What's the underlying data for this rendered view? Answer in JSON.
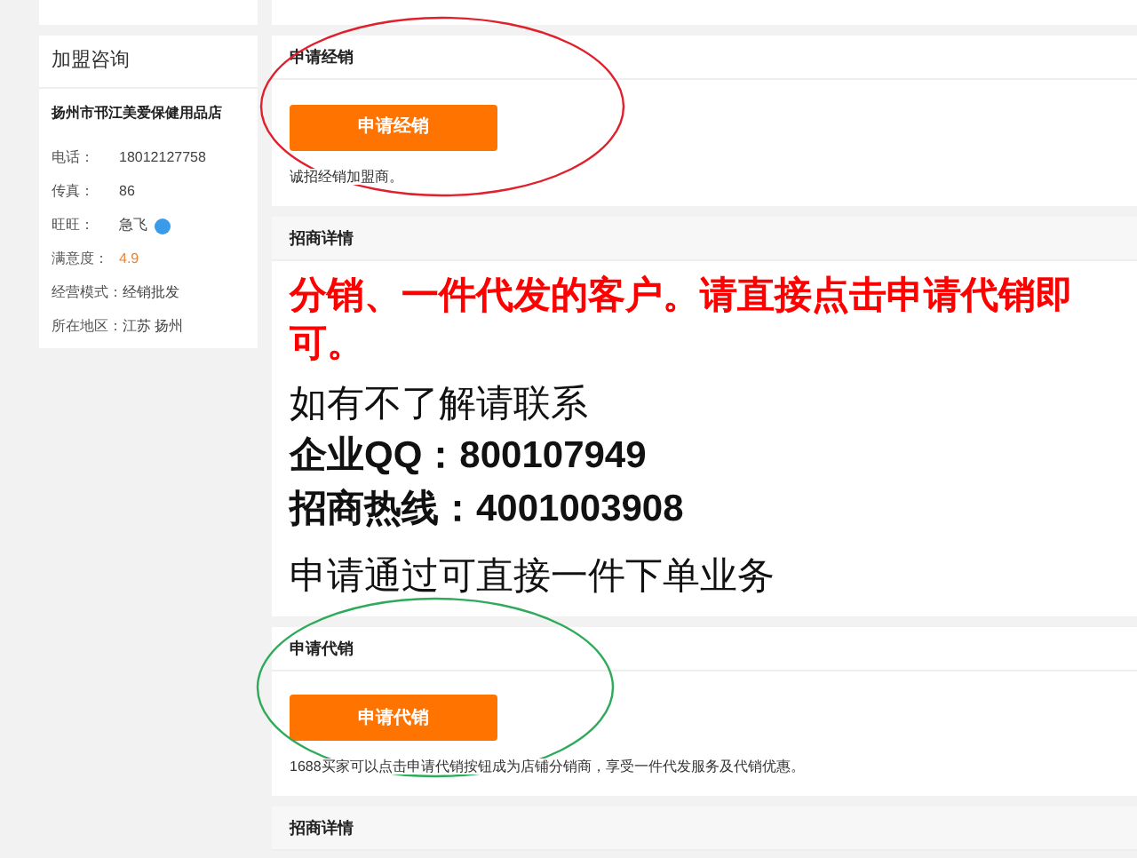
{
  "sidebar": {
    "title": "加盟咨询",
    "shop_name": "扬州市邗江美爱保健用品店",
    "fields": [
      {
        "label": "电话：",
        "value": "18012127758",
        "kind": "plain"
      },
      {
        "label": "传真：",
        "value": "86",
        "kind": "plain"
      },
      {
        "label": "旺旺：",
        "value": "急飞",
        "kind": "chat"
      },
      {
        "label": "满意度：",
        "value": "4.9",
        "kind": "score"
      },
      {
        "label": "经营模式：",
        "value": "经销批发",
        "kind": "inline"
      },
      {
        "label": "所在地区：",
        "value": "江苏 扬州",
        "kind": "inline"
      }
    ]
  },
  "sections": [
    {
      "kind": "apply",
      "title": "申请经销",
      "button": "申请经销",
      "note": "诚招经销加盟商。"
    },
    {
      "kind": "details",
      "title": "招商详情",
      "lines": [
        {
          "text": "分销、一件代发的客户。请直接点击申请代销即可。",
          "kind": "emphasis"
        },
        {
          "text": "如有不了解请联系",
          "kind": "plain"
        },
        {
          "text": "企业QQ：800107949",
          "kind": "strong"
        },
        {
          "text": "招商热线：4001003908",
          "kind": "strong"
        },
        {
          "text": "申请通过可直接一件下单业务",
          "kind": "plain"
        }
      ]
    },
    {
      "kind": "apply",
      "title": "申请代销",
      "button": "申请代销",
      "note": "1688买家可以点击申请代销按钮成为店铺分销商，享受一件代发服务及代销优惠。"
    },
    {
      "kind": "header",
      "title": "招商详情"
    }
  ]
}
